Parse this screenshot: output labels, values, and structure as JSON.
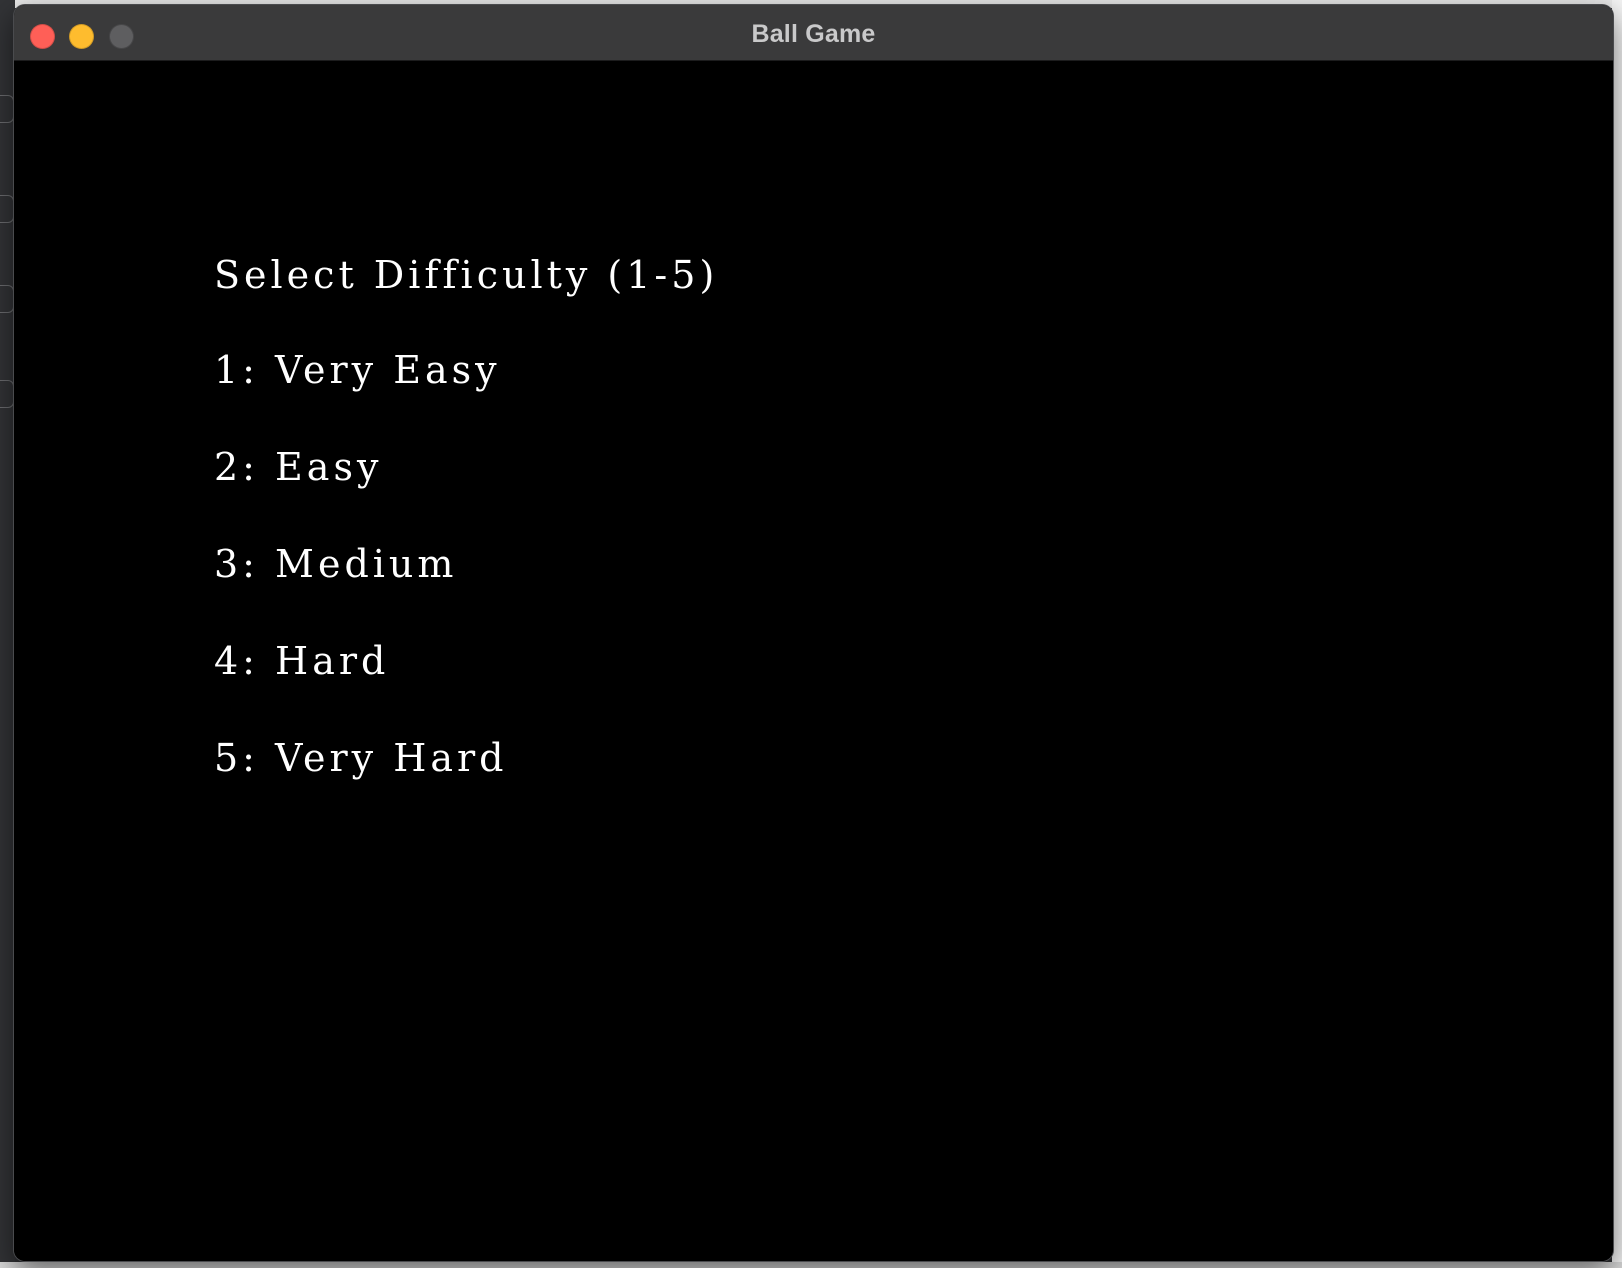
{
  "window": {
    "title": "Ball Game"
  },
  "menu": {
    "heading": "Select Difficulty (1-5)",
    "options": [
      "1: Very Easy",
      "2: Easy",
      "3: Medium",
      "4: Hard",
      "5: Very Hard"
    ]
  },
  "colors": {
    "background": "#000000",
    "text": "#ffffff",
    "titlebar": "#3a3a3b",
    "close": "#ff5f57",
    "minimize": "#febc2e",
    "zoom_inactive": "#5e5e60"
  },
  "icons": {
    "close": "close-icon",
    "minimize": "minimize-icon",
    "zoom": "zoom-icon"
  }
}
